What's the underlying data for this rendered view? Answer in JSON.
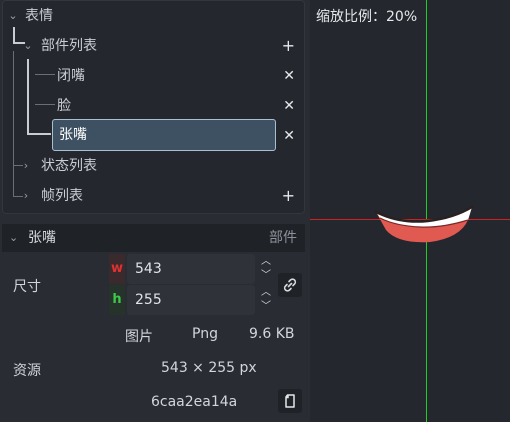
{
  "tree": {
    "root_label": "表情",
    "parts_label": "部件列表",
    "part_items": [
      {
        "label": "闭嘴"
      },
      {
        "label": "脸"
      },
      {
        "label": "张嘴"
      }
    ],
    "states_label": "状态列表",
    "frames_label": "帧列表",
    "add_symbol": "+",
    "delete_symbol": "✕"
  },
  "props": {
    "title": "张嘴",
    "kind": "部件",
    "size_label": "尺寸",
    "w_tag": "w",
    "h_tag": "h",
    "width": "543",
    "height": "255",
    "image_label": "图片",
    "format": "Png",
    "file_size": "9.6 KB",
    "resource_label": "资源",
    "dimensions": "543 × 255 px",
    "hash": "6caa2ea14a"
  },
  "canvas": {
    "zoom_text": "缩放比例：20%"
  },
  "colors": {
    "accent_green": "#22cc22",
    "accent_red": "#cc2222",
    "w_color": "#e0302f",
    "h_color": "#3ec84a",
    "mouth_red": "#e05a52"
  }
}
